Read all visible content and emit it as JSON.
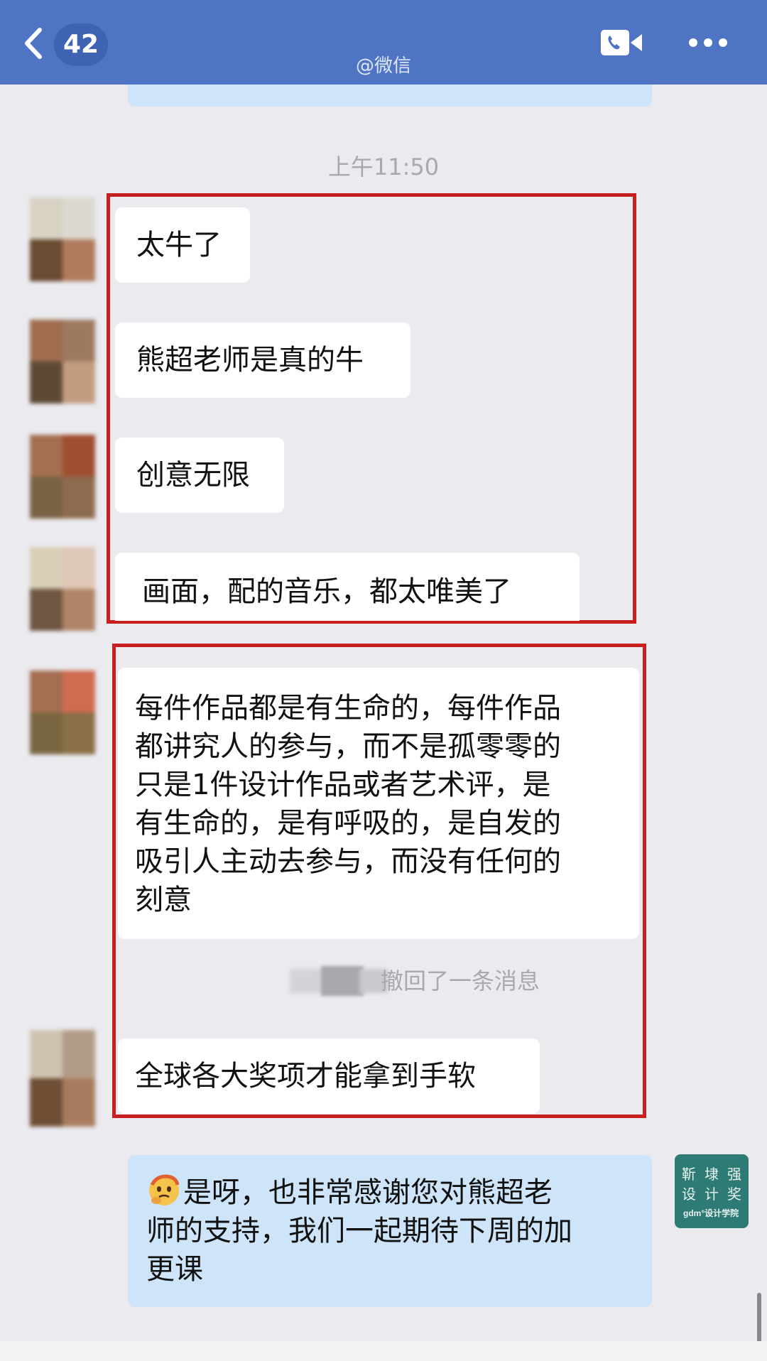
{
  "header": {
    "unread_count": "42",
    "subtitle": "@微信",
    "colors": {
      "bar": "#4f74c4",
      "badge": "#3f63b3"
    },
    "icons": [
      "back-chevron-icon",
      "video-call-icon",
      "more-icon"
    ]
  },
  "time_divider": "上午11:50",
  "messages": [
    {
      "text": "太牛了"
    },
    {
      "text": "熊超老师是真的牛"
    },
    {
      "text": "创意无限"
    },
    {
      "text": "画面，配的音乐，都太唯美了"
    },
    {
      "text_lines": [
        "每件作品都是有生命的，每件作品",
        "都讲究人的参与，而不是孤零零的",
        "只是1件设计作品或者艺术评，是",
        "有生命的，是有呼吸的，是自发的",
        "吸引人主动去参与，而没有任何的",
        "刻意"
      ]
    },
    {
      "recall_text": "撤回了一条消息"
    },
    {
      "text": "全球各大奖项才能拿到手软"
    }
  ],
  "my_message": {
    "emoji": "thinking-emoji-icon",
    "text_lines": [
      "是呀，也非常感谢您对熊超老",
      "师的支持，我们一起期待下周的加",
      "更课"
    ]
  },
  "my_avatar": {
    "chars": [
      "靳",
      "埭",
      "强",
      "设",
      "计",
      "奖"
    ],
    "sub": "gdm°设计学院",
    "color": "#2e7a74"
  },
  "highlight_color": "#c71f1f"
}
